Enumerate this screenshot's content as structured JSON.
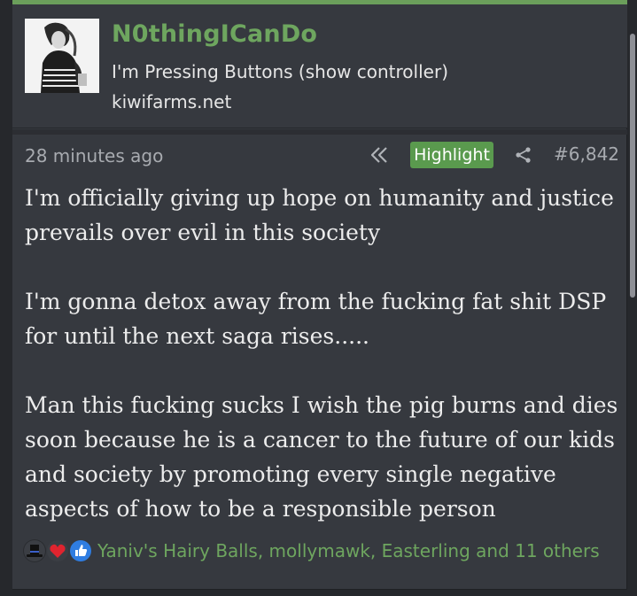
{
  "user": {
    "name": "N0thingICanDo",
    "title": "I'm Pressing Buttons (show controller)",
    "site": "kiwifarms.net"
  },
  "post": {
    "time": "28 minutes ago",
    "highlight_label": "Highlight",
    "number": "#6,842",
    "paragraphs": [
      "I'm officially giving up hope on humanity and justice prevails over evil in this society",
      "I'm gonna detox away from the fucking fat shit DSP for until the next saga rises.....",
      "Man this fucking sucks I wish the pig burns and dies soon because he is a cancer to the future of our kids and society by promoting every single negative aspects of how to be a responsible person"
    ]
  },
  "reactions": {
    "icons": [
      "top-hat-icon",
      "heart-icon",
      "thumbs-up-icon"
    ],
    "text": "Yaniv's Hairy Balls, mollymawk, Easterling and 11 others"
  },
  "colors": {
    "accent": "#6ea65f",
    "highlight_bg": "#5a9a4e",
    "background": "#36393f"
  }
}
